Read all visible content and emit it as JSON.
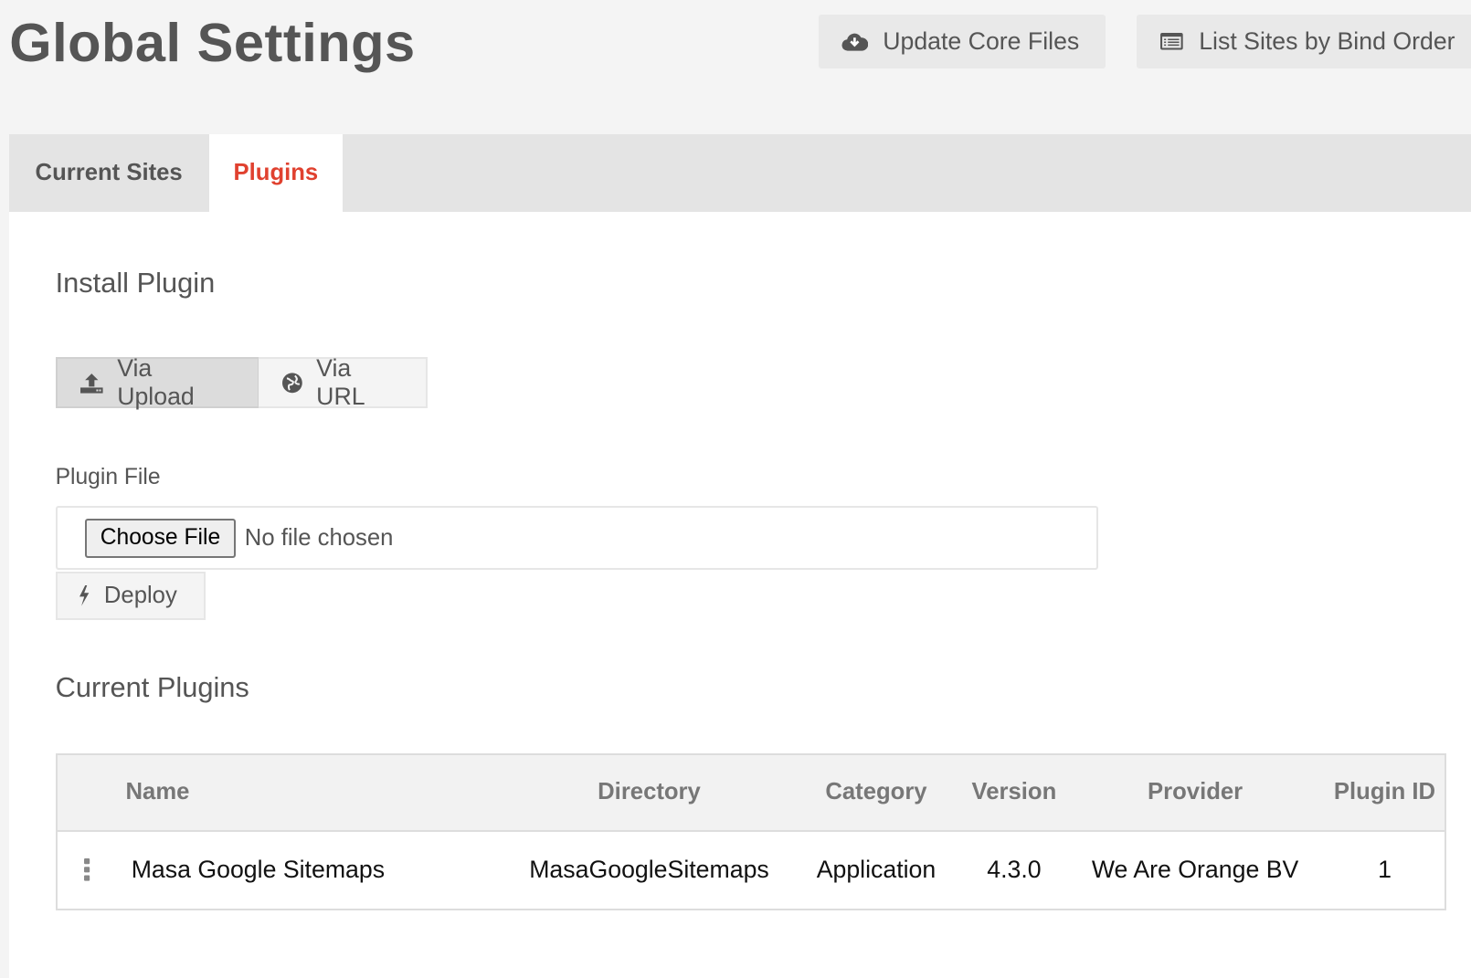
{
  "header": {
    "title": "Global Settings",
    "update_core_label": "Update Core Files",
    "list_sites_label": "List Sites by Bind Order"
  },
  "tabs": [
    {
      "label": "Current Sites",
      "active": false
    },
    {
      "label": "Plugins",
      "active": true
    }
  ],
  "accent_color": "#e0412f",
  "install": {
    "heading": "Install Plugin",
    "via_upload": "Via Upload",
    "via_url": "Via URL",
    "file_label": "Plugin File",
    "choose_file": "Choose File",
    "no_file": "No file chosen",
    "deploy": "Deploy"
  },
  "plugins": {
    "heading": "Current Plugins",
    "columns": [
      "Name",
      "Directory",
      "Category",
      "Version",
      "Provider",
      "Plugin ID"
    ],
    "rows": [
      [
        "Masa Google Sitemaps",
        "MasaGoogleSitemaps",
        "Application",
        "4.3.0",
        "We Are Orange BV",
        "1"
      ]
    ]
  }
}
